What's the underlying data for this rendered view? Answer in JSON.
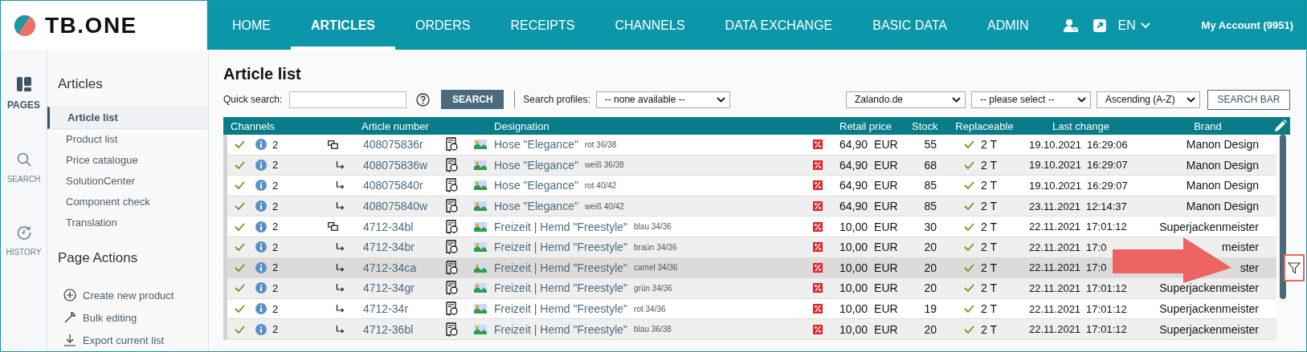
{
  "logo": {
    "text": "TB.ONE"
  },
  "nav": [
    {
      "label": "HOME",
      "selected": false
    },
    {
      "label": "ARTICLES",
      "selected": true
    },
    {
      "label": "ORDERS",
      "selected": false
    },
    {
      "label": "RECEIPTS",
      "selected": false
    },
    {
      "label": "CHANNELS",
      "selected": false
    },
    {
      "label": "DATA EXCHANGE",
      "selected": false
    },
    {
      "label": "BASIC DATA",
      "selected": false
    },
    {
      "label": "ADMIN",
      "selected": false
    }
  ],
  "language": "EN",
  "account": "My Account (9951)",
  "rail": [
    {
      "label": "PAGES",
      "kind": "pages",
      "selected": true
    },
    {
      "label": "SEARCH",
      "kind": "search",
      "selected": false
    },
    {
      "label": "HISTORY",
      "kind": "history",
      "selected": false
    }
  ],
  "sidebar": {
    "title": "Articles",
    "items": [
      {
        "label": "Article list",
        "selected": true
      },
      {
        "label": "Product list",
        "selected": false
      },
      {
        "label": "Price catalogue",
        "selected": false
      },
      {
        "label": "SolutionCenter",
        "selected": false
      },
      {
        "label": "Component check",
        "selected": false
      },
      {
        "label": "Translation",
        "selected": false
      }
    ],
    "actions_title": "Page Actions",
    "actions": [
      {
        "label": "Create new product",
        "kind": "create"
      },
      {
        "label": "Bulk editing",
        "kind": "edit"
      },
      {
        "label": "Export current list",
        "kind": "export"
      }
    ]
  },
  "page_title": "Article list",
  "toolbar": {
    "quick_search_label": "Quick search:",
    "search_button": "SEARCH",
    "profiles_label": "Search profiles:",
    "profiles_value": "-- none available --",
    "channel_value": "Zalando.de",
    "field_value": "-- please select --",
    "order_value": "Ascending (A-Z)",
    "search_bar_button": "SEARCH BAR"
  },
  "table": {
    "columns": [
      "Channels",
      "Article number",
      "Designation",
      "Retail price",
      "Stock",
      "Replaceable",
      "Last change",
      "Brand"
    ],
    "rows": [
      {
        "kind": "parent",
        "selected": false,
        "channels": "2",
        "article": "408075836r",
        "name": "Hose \"Elegance\"",
        "variant": "rot 36/38",
        "price": "64,90",
        "currency": "EUR",
        "stock": "55",
        "replaceable": "2 T",
        "date": "19.10.2021",
        "time": "16:29:06",
        "brand": "Manon Design"
      },
      {
        "kind": "variant",
        "selected": false,
        "channels": "2",
        "article": "408075836w",
        "name": "Hose \"Elegance\"",
        "variant": "weiß 36/38",
        "price": "64,90",
        "currency": "EUR",
        "stock": "68",
        "replaceable": "2 T",
        "date": "19.10.2021",
        "time": "16:29:07",
        "brand": "Manon Design"
      },
      {
        "kind": "variant",
        "selected": false,
        "channels": "2",
        "article": "408075840r",
        "name": "Hose \"Elegance\"",
        "variant": "rot 40/42",
        "price": "64,90",
        "currency": "EUR",
        "stock": "85",
        "replaceable": "2 T",
        "date": "19.10.2021",
        "time": "16:29:07",
        "brand": "Manon Design"
      },
      {
        "kind": "variant",
        "selected": false,
        "channels": "2",
        "article": "408075840w",
        "name": "Hose \"Elegance\"",
        "variant": "weiß 40/42",
        "price": "64,90",
        "currency": "EUR",
        "stock": "85",
        "replaceable": "2 T",
        "date": "23.11.2021",
        "time": "12:14:37",
        "brand": "Manon Design"
      },
      {
        "kind": "parent",
        "selected": false,
        "channels": "2",
        "article": "4712-34bl",
        "name": "Freizeit | Hemd \"Freestyle\"",
        "variant": "blau 34/36",
        "price": "10,00",
        "currency": "EUR",
        "stock": "30",
        "replaceable": "2 T",
        "date": "22.11.2021",
        "time": "17:01:12",
        "brand": "Superjackenmeister"
      },
      {
        "kind": "variant",
        "selected": false,
        "channels": "2",
        "article": "4712-34br",
        "name": "Freizeit | Hemd \"Freestyle\"",
        "variant": "braün 34/36",
        "price": "10,00",
        "currency": "EUR",
        "stock": "20",
        "replaceable": "2 T",
        "date": "22.11.2021",
        "time": "17:0",
        "brand": "meister"
      },
      {
        "kind": "variant",
        "selected": true,
        "channels": "2",
        "article": "4712-34ca",
        "name": "Freizeit | Hemd \"Freestyle\"",
        "variant": "camel 34/36",
        "price": "10,00",
        "currency": "EUR",
        "stock": "20",
        "replaceable": "2 T",
        "date": "22.11.2021",
        "time": "17:0",
        "brand": "ster"
      },
      {
        "kind": "variant",
        "selected": false,
        "channels": "2",
        "article": "4712-34gr",
        "name": "Freizeit | Hemd \"Freestyle\"",
        "variant": "grün 34/36",
        "price": "10,00",
        "currency": "EUR",
        "stock": "20",
        "replaceable": "2 T",
        "date": "22.11.2021",
        "time": "17:01:12",
        "brand": "Superjackenmeister"
      },
      {
        "kind": "variant",
        "selected": false,
        "channels": "2",
        "article": "4712-34r",
        "name": "Freizeit | Hemd \"Freestyle\"",
        "variant": "rot 34/36",
        "price": "10,00",
        "currency": "EUR",
        "stock": "19",
        "replaceable": "2 T",
        "date": "22.11.2021",
        "time": "17:01:12",
        "brand": "Superjackenmeister"
      },
      {
        "kind": "variant",
        "selected": false,
        "channels": "2",
        "article": "4712-36bl",
        "name": "Freizeit | Hemd \"Freestyle\"",
        "variant": "blau 36/38",
        "price": "10,00",
        "currency": "EUR",
        "stock": "20",
        "replaceable": "2 T",
        "date": "22.11.2021",
        "time": "17:01:12",
        "brand": "Superjackenmeister"
      }
    ]
  }
}
